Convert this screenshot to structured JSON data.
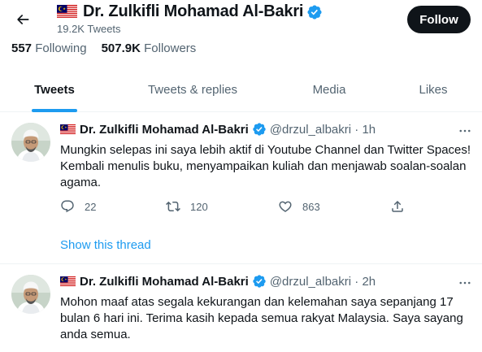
{
  "header": {
    "flag_icon": "malaysia-flag-icon",
    "name": "Dr. Zulkifli Mohamad Al-Bakri",
    "tweet_count": "19.2K Tweets",
    "follow_label": "Follow"
  },
  "stats": {
    "following_count": "557",
    "following_label": "Following",
    "followers_count": "507.9K",
    "followers_label": "Followers"
  },
  "tabs": [
    {
      "label": "Tweets",
      "active": true
    },
    {
      "label": "Tweets & replies",
      "active": false
    },
    {
      "label": "Media",
      "active": false
    },
    {
      "label": "Likes",
      "active": false
    }
  ],
  "tweets": [
    {
      "name": "Dr. Zulkifli Mohamad Al-Bakri",
      "handle": "@drzul_albakri",
      "time": "1h",
      "text": "Mungkin selepas ini saya lebih aktif di Youtube Channel dan Twitter Spaces! Kembali menulis buku, menyampaikan kuliah dan menjawab soalan-soalan agama.",
      "replies": "22",
      "retweets": "120",
      "likes": "863",
      "show_thread": "Show this thread"
    },
    {
      "name": "Dr. Zulkifli Mohamad Al-Bakri",
      "handle": "@drzul_albakri",
      "time": "2h",
      "text": "Mohon maaf atas segala kekurangan dan kelemahan saya sepanjang 17 bulan 6 hari ini. Terima kasih kepada semua rakyat Malaysia. Saya sayang anda semua."
    }
  ],
  "colors": {
    "accent": "#1d9bf0",
    "text_primary": "#0f1419",
    "text_secondary": "#536471",
    "follow_bg": "#0f1419"
  }
}
